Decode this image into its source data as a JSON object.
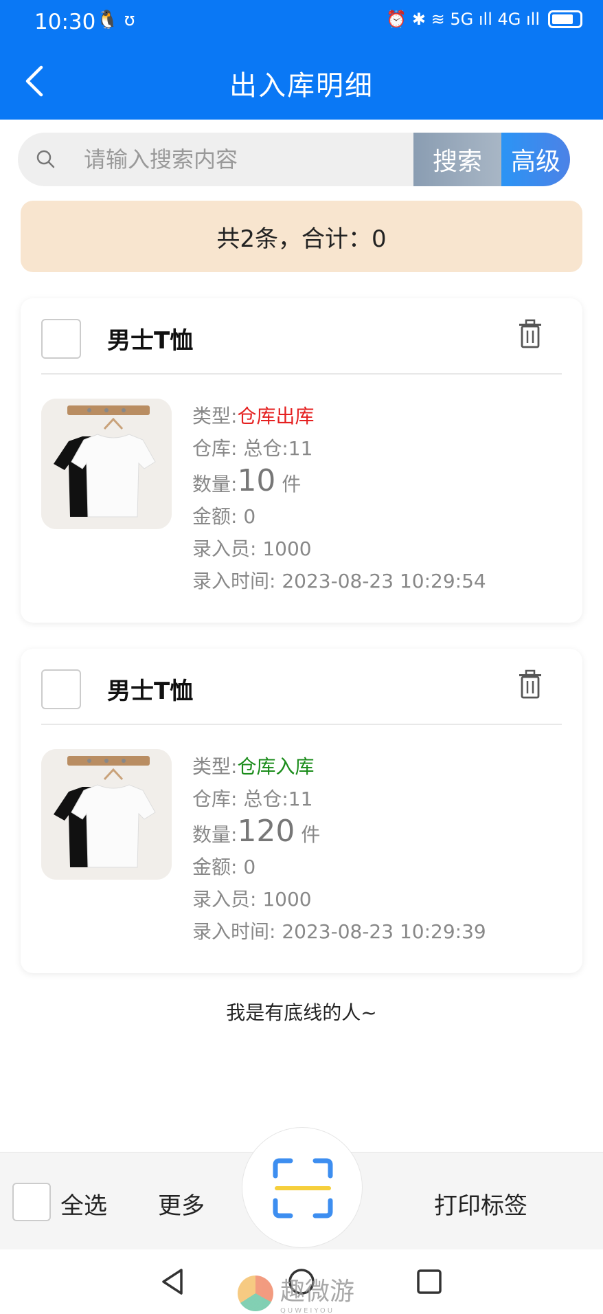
{
  "status_bar": {
    "time": "10:30",
    "left_icons": "🐧 ʊ",
    "right_icons": "⏰ ✱ ≋ 5G ıll 4G ıll"
  },
  "header": {
    "title": "出入库明细"
  },
  "search": {
    "placeholder": "请输入搜索内容",
    "search_label": "搜索",
    "advanced_label": "高级"
  },
  "summary": {
    "text": "共2条，合计：0"
  },
  "records": [
    {
      "name": "男士T恤",
      "type_label": "类型:",
      "type_value": "仓库出库",
      "type_color": "#e52020",
      "warehouse": "仓库: 总仓:11",
      "qty_label": "数量:",
      "qty_value": "10",
      "qty_unit": " 件",
      "amount": "金额: 0",
      "operator": "录入员: 1000",
      "time": "录入时间: 2023-08-23 10:29:54"
    },
    {
      "name": "男士T恤",
      "type_label": "类型:",
      "type_value": "仓库入库",
      "type_color": "#1b8c1b",
      "warehouse": "仓库: 总仓:11",
      "qty_label": "数量:",
      "qty_value": "120",
      "qty_unit": " 件",
      "amount": "金额: 0",
      "operator": "录入员: 1000",
      "time": "录入时间: 2023-08-23 10:29:39"
    }
  ],
  "footer": {
    "end_text": "我是有底线的人~"
  },
  "bottom_bar": {
    "select_all": "全选",
    "more": "更多",
    "print": "打印标签"
  },
  "watermark": {
    "text": "趣微游",
    "sub": "QUWEIYOU"
  }
}
